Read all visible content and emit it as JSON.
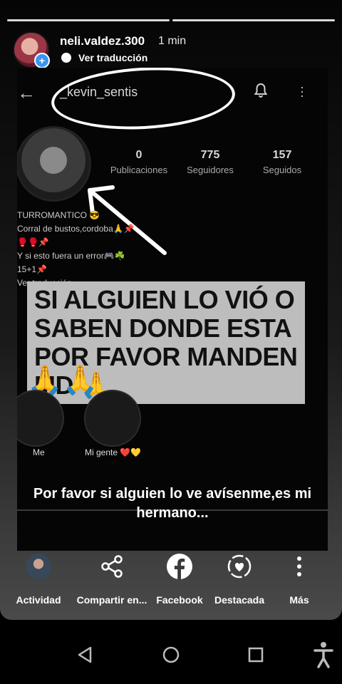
{
  "story": {
    "username": "neli.valdez.300",
    "time": "1 min",
    "translate_label": "Ver traducción"
  },
  "screenshot": {
    "profile_name": "_kevin_sentis",
    "stats": [
      {
        "value": "0",
        "label": "Publicaciones"
      },
      {
        "value": "775",
        "label": "Seguidores"
      },
      {
        "value": "157",
        "label": "Seguidos"
      }
    ],
    "bio_lines": [
      "TURROMANTICO 😎",
      "Corral de bustos,cordoba🙏📌",
      "🥊🥊📌",
      "Y si esto fuera un error🎮☘️",
      "15+1📌",
      "Ver traducción"
    ],
    "overlay_text": "SI ALGUIEN LO VIÓ O SABEN DONDE ESTA POR FAVOR MANDEN MD 🙏",
    "prayer_emojis": "🙏🙏",
    "highlights": [
      {
        "label": "Me"
      },
      {
        "label": "Mi gente ❤️💛"
      }
    ],
    "caption": "Por favor si alguien lo ve avísenme,es mi hermano..."
  },
  "actions": [
    {
      "label": "Actividad",
      "icon": "activity-avatar"
    },
    {
      "label": "Compartir en...",
      "icon": "share-icon"
    },
    {
      "label": "Facebook",
      "icon": "facebook-icon"
    },
    {
      "label": "Destacada",
      "icon": "highlight-heart-icon"
    },
    {
      "label": "Más",
      "icon": "more-vertical-icon"
    }
  ],
  "colors": {
    "accent_blue": "#3897f0",
    "overlay_bg": "#bdbdbd"
  }
}
